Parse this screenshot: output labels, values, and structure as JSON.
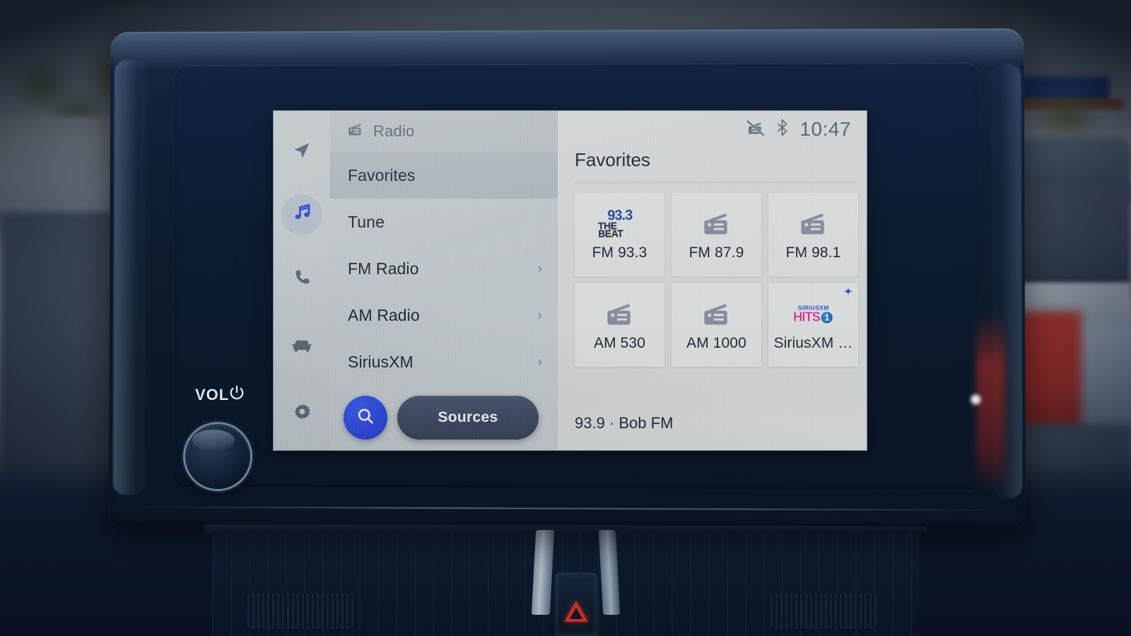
{
  "vehicle_controls": {
    "volume_label": "VOL",
    "power_icon": "power-icon",
    "knob": "volume-knob",
    "hazard_icon": "hazard-triangle-icon"
  },
  "screen": {
    "rail": {
      "items": [
        {
          "icon": "navigation-arrow-icon",
          "name": "navigation",
          "active": false
        },
        {
          "icon": "music-note-icon",
          "name": "media",
          "active": true
        },
        {
          "icon": "phone-icon",
          "name": "phone",
          "active": false
        },
        {
          "icon": "car-icon",
          "name": "vehicle",
          "active": false
        },
        {
          "icon": "gear-icon",
          "name": "settings",
          "active": false
        }
      ],
      "active_color": "#2b46e2"
    },
    "center_panel": {
      "header": {
        "icon": "radio-icon",
        "title": "Radio"
      },
      "menu": [
        {
          "label": "Favorites",
          "selected": true,
          "chevron": ""
        },
        {
          "label": "Tune",
          "selected": false,
          "chevron": ""
        },
        {
          "label": "FM Radio",
          "selected": false,
          "chevron": "›"
        },
        {
          "label": "AM Radio",
          "selected": false,
          "chevron": "›"
        },
        {
          "label": "SiriusXM",
          "selected": false,
          "chevron": "›"
        }
      ],
      "search_button": {
        "icon": "search-icon",
        "color": "#2b46e2"
      },
      "sources_button": {
        "label": "Sources"
      }
    },
    "right_panel": {
      "status_bar": {
        "icons": [
          "mute-radio-icon",
          "bluetooth-icon"
        ],
        "clock": "10:47"
      },
      "title": "Favorites",
      "tiles": [
        {
          "label": "FM 93.3",
          "icon": "station-logo-933-the-beat",
          "logo_text_top": "93.3",
          "logo_text_bottom": "THE BEAT",
          "badge": ""
        },
        {
          "label": "FM 87.9",
          "icon": "radio-icon",
          "badge": ""
        },
        {
          "label": "FM 98.1",
          "icon": "radio-icon",
          "badge": ""
        },
        {
          "label": "AM 530",
          "icon": "radio-icon",
          "badge": ""
        },
        {
          "label": "AM 1000",
          "icon": "radio-icon",
          "badge": ""
        },
        {
          "label": "SiriusXM …",
          "icon": "siriusxm-hits-1-logo",
          "logo_text_top": "SIRIUSXM",
          "logo_text_mid": "HITS",
          "logo_text_num": "1",
          "badge": "siriusxm-badge-icon"
        }
      ],
      "now_playing": "93.9 · Bob FM"
    }
  },
  "colors": {
    "accent_blue": "#2b46e2",
    "screen_bg": "#dcdfdf",
    "panel_bg": "#c9d0d3",
    "rail_bg": "#ced4d6",
    "text_primary": "#1d2533",
    "text_muted": "#60697a",
    "sources_bg": "#3b4660"
  }
}
